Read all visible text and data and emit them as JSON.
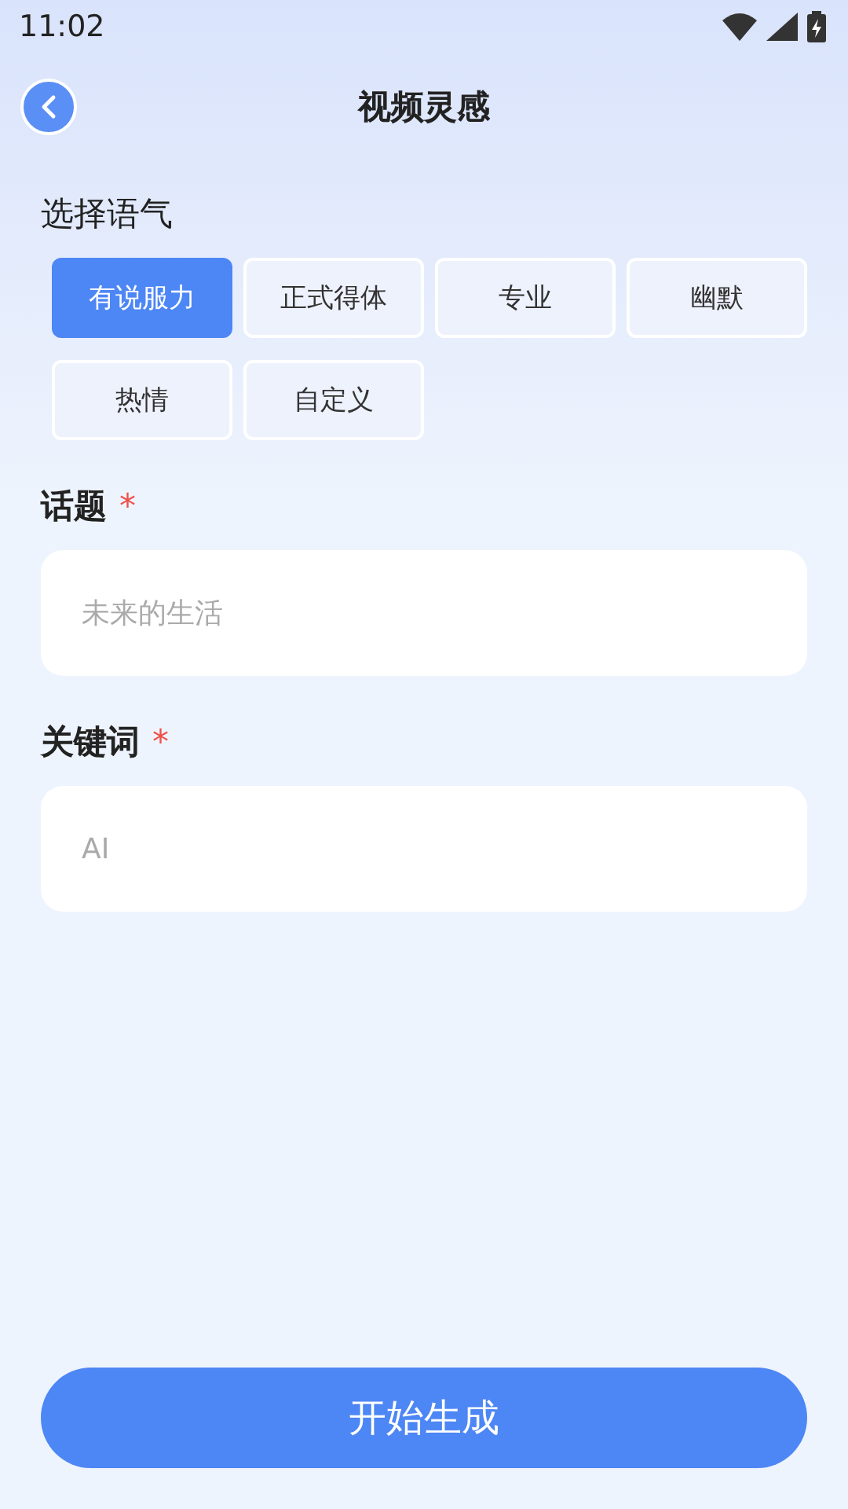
{
  "status_bar": {
    "time": "11:02"
  },
  "header": {
    "title": "视频灵感"
  },
  "tone": {
    "label": "选择语气",
    "options": [
      {
        "label": "有说服力",
        "selected": true
      },
      {
        "label": "正式得体",
        "selected": false
      },
      {
        "label": "专业",
        "selected": false
      },
      {
        "label": "幽默",
        "selected": false
      },
      {
        "label": "热情",
        "selected": false
      },
      {
        "label": "自定义",
        "selected": false
      }
    ]
  },
  "fields": [
    {
      "label": "话题",
      "required_mark": "*",
      "placeholder": "未来的生活"
    },
    {
      "label": "关键词",
      "required_mark": "*",
      "placeholder": "AI"
    }
  ],
  "submit_button": "开始生成"
}
